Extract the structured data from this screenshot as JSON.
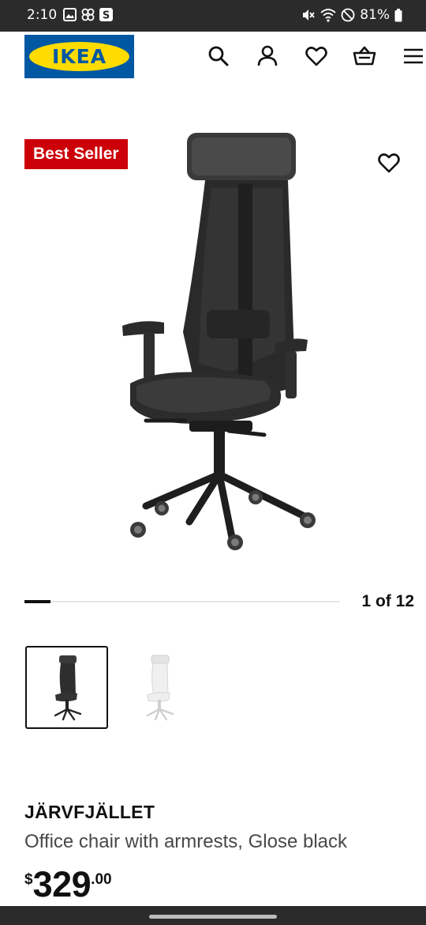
{
  "status_bar": {
    "time": "2:10",
    "battery": "81%",
    "left_icons": [
      "gallery-icon",
      "pinwheel-icon",
      "s-app-icon"
    ],
    "right_icons": [
      "mute-icon",
      "wifi-icon",
      "do-not-disturb-icon",
      "battery-icon"
    ]
  },
  "header": {
    "logo_text": "IKEA",
    "icons": [
      "search-icon",
      "account-icon",
      "wishlist-heart-icon",
      "shopping-basket-icon",
      "menu-icon"
    ]
  },
  "product": {
    "badge": "Best Seller",
    "name": "JÄRVFJÄLLET",
    "description": "Office chair with armrests, Glose black",
    "price_currency": "$",
    "price_integer": "329",
    "price_decimal": ".00"
  },
  "gallery": {
    "counter": "1 of 12",
    "current": 1,
    "total": 12
  },
  "colors": {
    "ikea_blue": "#0058a3",
    "ikea_yellow": "#ffdb00",
    "badge_red": "#cc0008"
  }
}
